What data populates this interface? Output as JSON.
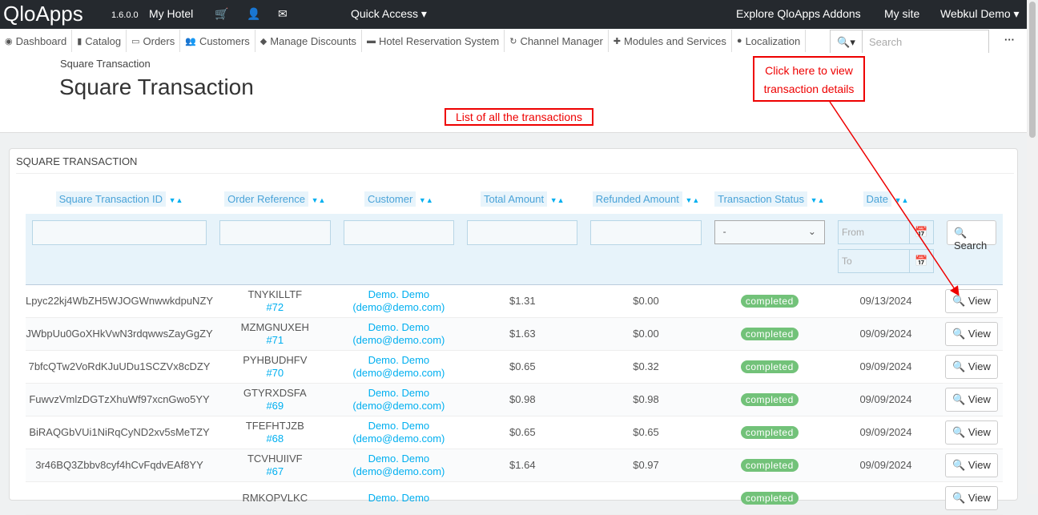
{
  "topbar": {
    "logo": "QloApps",
    "version": "1.6.0.0",
    "shop": "My Hotel",
    "quick_access": "Quick Access",
    "addons": "Explore QloApps Addons",
    "my_site": "My site",
    "user": "Webkul Demo"
  },
  "nav": [
    {
      "icon": "dashboard-icon",
      "glyph": "◉",
      "label": "Dashboard"
    },
    {
      "icon": "book-icon",
      "glyph": "▮",
      "label": "Catalog"
    },
    {
      "icon": "credit-card-icon",
      "glyph": "▭",
      "label": "Orders"
    },
    {
      "icon": "users-icon",
      "glyph": "👥",
      "label": "Customers"
    },
    {
      "icon": "tag-icon",
      "glyph": "◆",
      "label": "Manage Discounts"
    },
    {
      "icon": "bed-icon",
      "glyph": "▬",
      "label": "Hotel Reservation System"
    },
    {
      "icon": "refresh-icon",
      "glyph": "↻",
      "label": "Channel Manager"
    },
    {
      "icon": "puzzle-icon",
      "glyph": "✚",
      "label": "Modules and Services"
    },
    {
      "icon": "globe-icon",
      "glyph": "●",
      "label": "Localization"
    }
  ],
  "search": {
    "placeholder": "Search"
  },
  "page": {
    "breadcrumb": "Square Transaction",
    "title": "Square Transaction"
  },
  "annotations": {
    "list": "List of all the transactions",
    "view_line1": "Click here to view",
    "view_line2": "transaction details"
  },
  "panel": {
    "title": "Square Transaction",
    "columns": [
      "Square Transaction ID",
      "Order Reference",
      "Customer",
      "Total Amount",
      "Refunded Amount",
      "Transaction Status",
      "Date"
    ],
    "status_select": "-",
    "from_placeholder": "From",
    "to_placeholder": "To",
    "search_label": "Search",
    "view_label": "View"
  },
  "rows": [
    {
      "id": "Lpyc22kj4WbZH5WJOGWnwwkdpuNZY",
      "ref": "TNYKILLTF",
      "order": "#72",
      "customer": "Demo. Demo",
      "email": "(demo@demo.com)",
      "total": "$1.31",
      "refunded": "$0.00",
      "status": "completed",
      "date": "09/13/2024"
    },
    {
      "id": "JWbpUu0GoXHkVwN3rdqwwsZayGgZY",
      "ref": "MZMGNUXEH",
      "order": "#71",
      "customer": "Demo. Demo",
      "email": "(demo@demo.com)",
      "total": "$1.63",
      "refunded": "$0.00",
      "status": "completed",
      "date": "09/09/2024"
    },
    {
      "id": "7bfcQTw2VoRdKJuUDu1SCZVx8cDZY",
      "ref": "PYHBUDHFV",
      "order": "#70",
      "customer": "Demo. Demo",
      "email": "(demo@demo.com)",
      "total": "$0.65",
      "refunded": "$0.32",
      "status": "completed",
      "date": "09/09/2024"
    },
    {
      "id": "FuwvzVmlzDGTzXhuWf97xcnGwo5YY",
      "ref": "GTYRXDSFA",
      "order": "#69",
      "customer": "Demo. Demo",
      "email": "(demo@demo.com)",
      "total": "$0.98",
      "refunded": "$0.98",
      "status": "completed",
      "date": "09/09/2024"
    },
    {
      "id": "BiRAQGbVUi1NiRqCyND2xv5sMeTZY",
      "ref": "TFEFHTJZB",
      "order": "#68",
      "customer": "Demo. Demo",
      "email": "(demo@demo.com)",
      "total": "$0.65",
      "refunded": "$0.65",
      "status": "completed",
      "date": "09/09/2024"
    },
    {
      "id": "3r46BQ3Zbbv8cyf4hCvFqdvEAf8YY",
      "ref": "TCVHUIIVF",
      "order": "#67",
      "customer": "Demo. Demo",
      "email": "(demo@demo.com)",
      "total": "$1.64",
      "refunded": "$0.97",
      "status": "completed",
      "date": "09/09/2024"
    },
    {
      "id": "",
      "ref": "RMKOPVLKC",
      "order": "",
      "customer": "Demo. Demo",
      "email": "",
      "total": "",
      "refunded": "",
      "status": "completed",
      "date": ""
    }
  ],
  "colors": {
    "topbar": "#25292e",
    "accent": "#00aff0",
    "badge": "#72c279",
    "annotation": "#ee0000"
  }
}
